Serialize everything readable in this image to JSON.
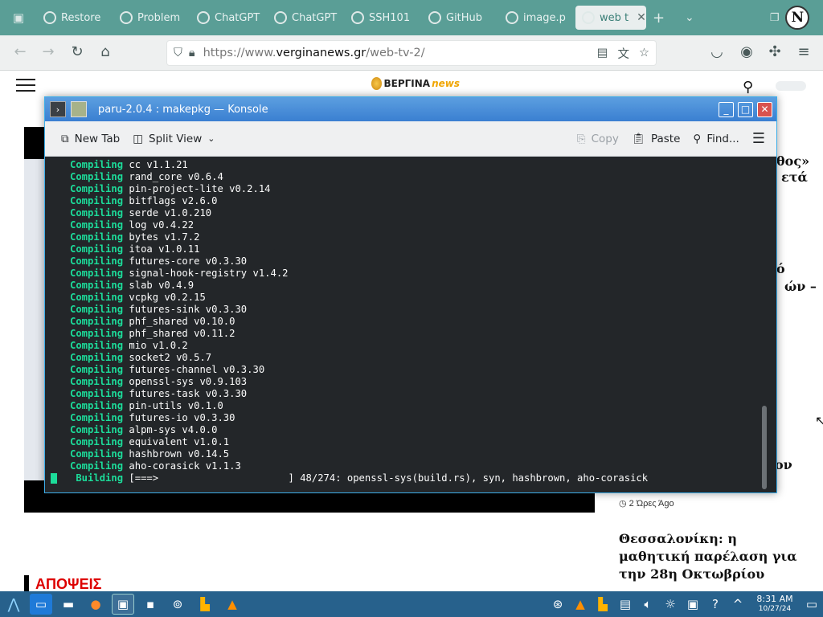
{
  "browser": {
    "tabs": [
      {
        "label": "Restore",
        "icon": "restore-icon"
      },
      {
        "label": "Problem",
        "icon": "problem-icon"
      },
      {
        "label": "ChatGPT",
        "icon": "chatgpt-icon"
      },
      {
        "label": "ChatGPT",
        "icon": "chatgpt-icon"
      },
      {
        "label": "SSH101",
        "icon": "ssh-icon"
      },
      {
        "label": "GitHub",
        "icon": "github-icon"
      },
      {
        "label": "image.p",
        "icon": "image-icon"
      },
      {
        "label": "web t",
        "icon": "web-tv-icon",
        "active": true
      }
    ],
    "profile_initial": "N",
    "url": {
      "scheme": "https://www.",
      "host": "verginanews.gr",
      "path": "/web-tv-2/"
    }
  },
  "site": {
    "logo_main": "ΒΕΡΓΙΝΑ",
    "logo_accent": "news",
    "side_fragments": [
      "θος»",
      "ετά",
      "ό",
      "ών –",
      "ον"
    ],
    "time_ago": "2 Ώρες Άgo",
    "headline": "Θεσσαλονίκη: η μαθητική παρέλαση για την 28η Οκτωβρίου",
    "section": "ΑΠΟΨΕΙΣ"
  },
  "konsole": {
    "title": "paru-2.0.4 : makepkg — Konsole",
    "toolbar": {
      "new_tab": "New Tab",
      "split_view": "Split View",
      "copy": "Copy",
      "paste": "Paste",
      "find": "Find..."
    },
    "keyword": "Compiling",
    "crates": [
      "cc v1.1.21",
      "rand_core v0.6.4",
      "pin-project-lite v0.2.14",
      "bitflags v2.6.0",
      "serde v1.0.210",
      "log v0.4.22",
      "bytes v1.7.2",
      "itoa v1.0.11",
      "futures-core v0.3.30",
      "signal-hook-registry v1.4.2",
      "slab v0.4.9",
      "vcpkg v0.2.15",
      "futures-sink v0.3.30",
      "phf_shared v0.10.0",
      "phf_shared v0.11.2",
      "mio v1.0.2",
      "socket2 v0.5.7",
      "futures-channel v0.3.30",
      "openssl-sys v0.9.103",
      "futures-task v0.3.30",
      "pin-utils v0.1.0",
      "futures-io v0.3.30",
      "alpm-sys v4.0.0",
      "equivalent v1.0.1",
      "hashbrown v0.14.5",
      "aho-corasick v1.1.3"
    ],
    "building_label": "Building",
    "progress_bar": "[===>                      ]",
    "progress_text": "48/274: openssl-sys(build.rs), syn, hashbrown, aho-corasick"
  },
  "taskbar": {
    "time": "8:31 AM",
    "date": "10/27/24"
  },
  "colors": {
    "accent": "#3daee9",
    "tabbar": "#5a9e96",
    "terminal_bg": "#232629",
    "compiling_green": "#1cdc9a",
    "taskbar": "#27618c"
  }
}
